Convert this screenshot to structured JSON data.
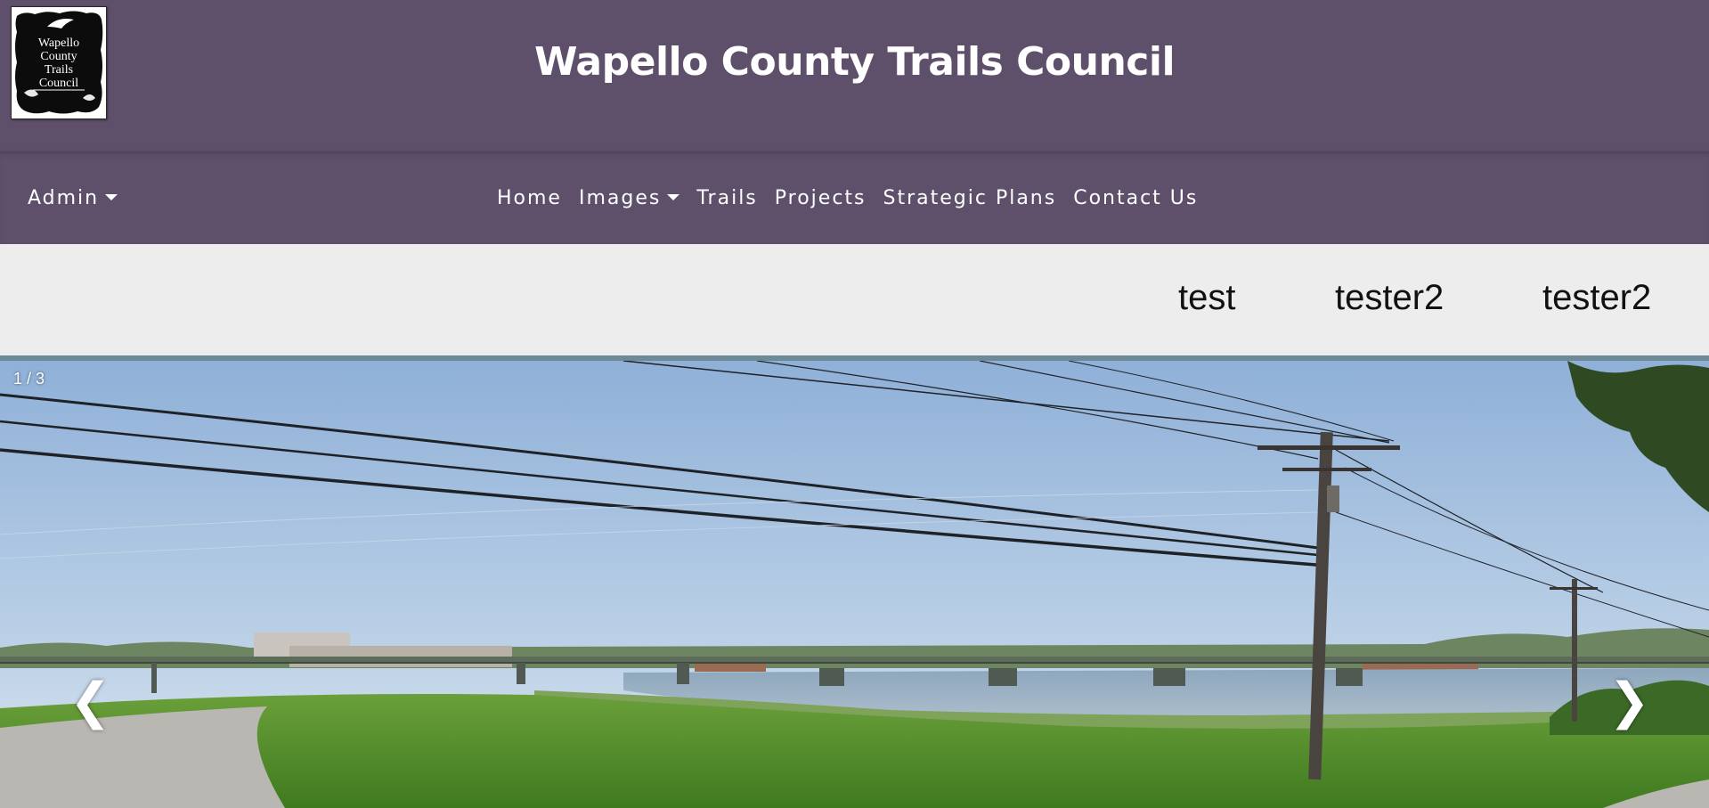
{
  "header": {
    "title": "Wapello County Trails Council",
    "logo_text": "Wapello County Trails Council"
  },
  "nav": {
    "admin_label": "Admin",
    "links": [
      "Home",
      "Images",
      "Trails",
      "Projects",
      "Strategic Plans",
      "Contact Us"
    ]
  },
  "strip": {
    "items": [
      "test",
      "tester2",
      "tester2"
    ]
  },
  "slideshow": {
    "counter": "1 / 3",
    "prev_symbol": "❮",
    "next_symbol": "❯"
  },
  "colors": {
    "header_bg": "#5e4f6b",
    "strip_bg": "#ededed",
    "slide_border": "#6e8a96"
  },
  "icons": [
    "chevron-down-icon",
    "chevron-left-icon",
    "chevron-right-icon"
  ]
}
